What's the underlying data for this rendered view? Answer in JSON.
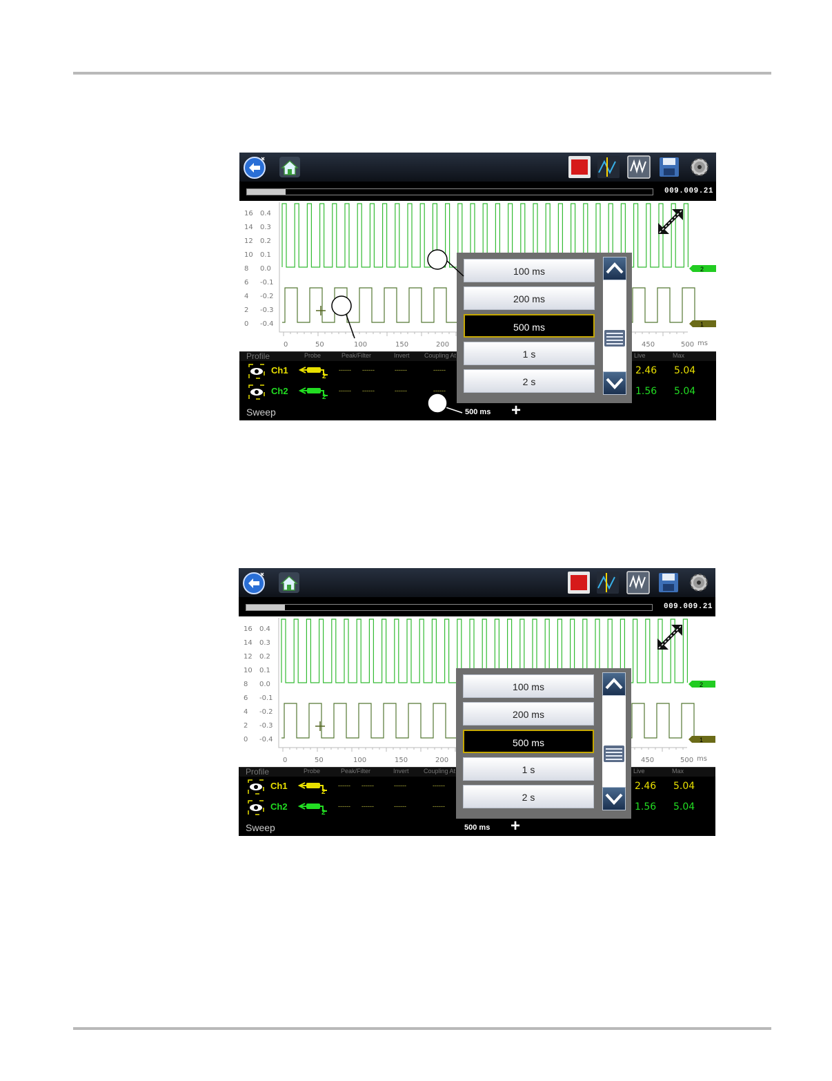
{
  "screens": [
    {
      "firmware": "009.009.21",
      "left_axis_labels": [
        "16",
        "14",
        "12",
        "10",
        "8",
        "6",
        "4",
        "2",
        "0"
      ],
      "right_axis_labels": [
        "0.4",
        "0.3",
        "0.2",
        "0.1",
        "0.0",
        "-0.1",
        "-0.2",
        "-0.3",
        "-0.4"
      ],
      "x_ticks": [
        "0",
        "50",
        "100",
        "150",
        "200",
        "450",
        "500"
      ],
      "x_unit": "ms",
      "dropdown": {
        "options": [
          "100 ms",
          "200 ms",
          "500 ms",
          "1 s",
          "2 s"
        ],
        "selected": "500 ms"
      },
      "headers": {
        "profile": "Profile",
        "probe": "Probe",
        "peak_filter": "Peak/Filter",
        "invert": "Invert",
        "coupling": "Coupling At",
        "live": "Live",
        "max": "Max"
      },
      "channels": [
        {
          "name": "Ch1",
          "live": "2.46",
          "max": "5.04"
        },
        {
          "name": "Ch2",
          "live": "1.56",
          "max": "5.04"
        }
      ],
      "sweep_label": "Sweep",
      "sweep_value": "500 ms",
      "trace_markers": [
        "2",
        "1"
      ]
    },
    {
      "firmware": "009.009.21",
      "left_axis_labels": [
        "16",
        "14",
        "12",
        "10",
        "8",
        "6",
        "4",
        "2",
        "0"
      ],
      "right_axis_labels": [
        "0.4",
        "0.3",
        "0.2",
        "0.1",
        "0.0",
        "-0.1",
        "-0.2",
        "-0.3",
        "-0.4"
      ],
      "x_ticks": [
        "0",
        "50",
        "100",
        "150",
        "200",
        "450",
        "500"
      ],
      "x_unit": "ms",
      "dropdown": {
        "options": [
          "100 ms",
          "200 ms",
          "500 ms",
          "1 s",
          "2 s"
        ],
        "selected": "500 ms"
      },
      "headers": {
        "profile": "Profile",
        "probe": "Probe",
        "peak_filter": "Peak/Filter",
        "invert": "Invert",
        "coupling": "Coupling At",
        "live": "Live",
        "max": "Max"
      },
      "channels": [
        {
          "name": "Ch1",
          "live": "2.46",
          "max": "5.04"
        },
        {
          "name": "Ch2",
          "live": "1.56",
          "max": "5.04"
        }
      ],
      "sweep_label": "Sweep",
      "sweep_value": "500 ms",
      "trace_markers": [
        "2",
        "1"
      ]
    }
  ],
  "colors": {
    "ch1": "#e8e000",
    "ch2": "#22dd22",
    "trace_top": "#33bb33",
    "trace_bottom": "#557733"
  }
}
